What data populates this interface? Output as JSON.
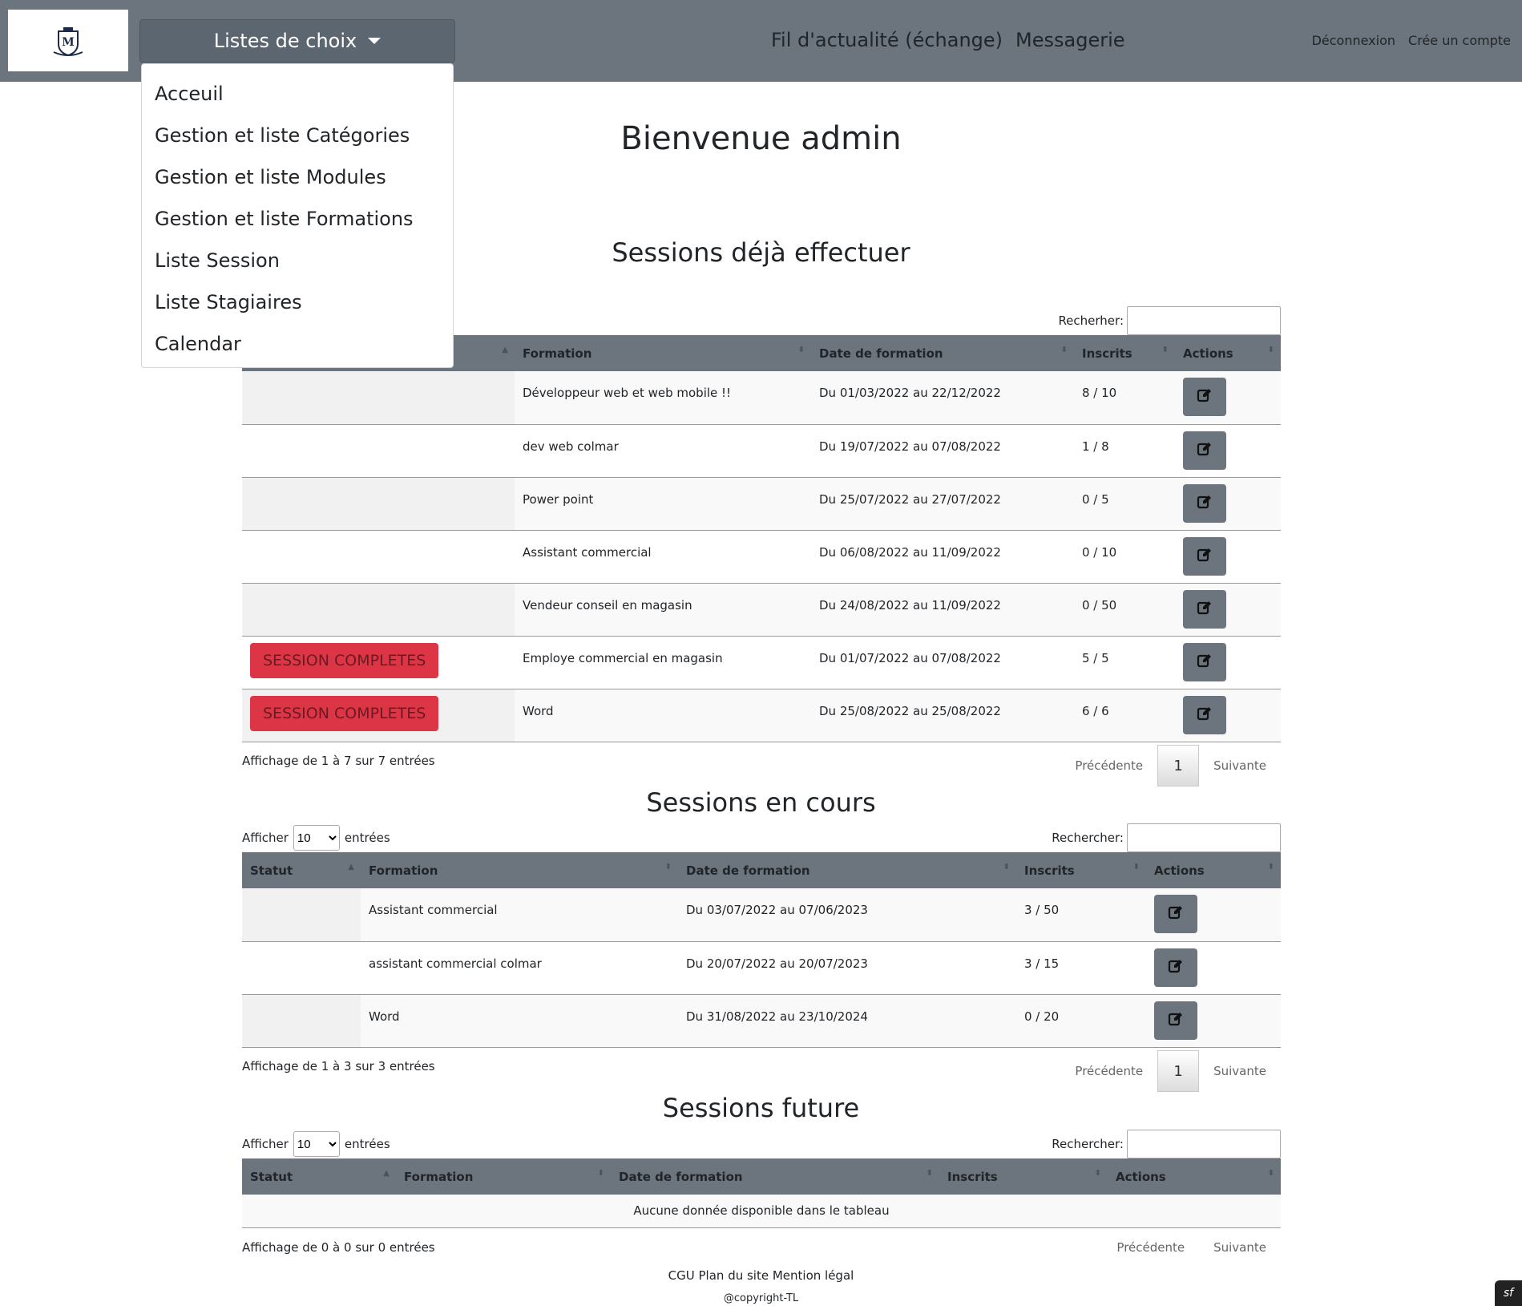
{
  "nav": {
    "dropdown_label": "Listes de choix",
    "center_links": [
      "Fil d'actualité (échange)",
      "Messagerie"
    ],
    "right_links": [
      "Déconnexion",
      "Crée un compte"
    ],
    "bg_color": "#6c757d"
  },
  "dropdown_items": [
    "Acceuil",
    "Gestion et liste Catégories",
    "Gestion et liste Modules",
    "Gestion et liste Formations",
    "Liste Session",
    "Liste Stagiaires",
    "Calendar"
  ],
  "page_title": "Bienvenue admin",
  "done": {
    "title": "Sessions déjà effectuer",
    "search_label": "Recherher:",
    "headers": [
      "Formation",
      "Date de formation",
      "Inscrits",
      "Actions"
    ],
    "rows": [
      {
        "statut": "",
        "formation": "Développeur web et web mobile !!",
        "date": "Du 01/03/2022 au 22/12/2022",
        "inscrits": "8 / 10"
      },
      {
        "statut": "",
        "formation": "dev web colmar",
        "date": "Du 19/07/2022 au 07/08/2022",
        "inscrits": "1 / 8"
      },
      {
        "statut": "",
        "formation": "Power point",
        "date": "Du 25/07/2022 au 27/07/2022",
        "inscrits": "0 / 5"
      },
      {
        "statut": "",
        "formation": "Assistant commercial",
        "date": "Du 06/08/2022 au 11/09/2022",
        "inscrits": "0 / 10"
      },
      {
        "statut": "",
        "formation": "Vendeur conseil en magasin",
        "date": "Du 24/08/2022 au 11/09/2022",
        "inscrits": "0 / 50"
      },
      {
        "statut": "SESSION COMPLETES",
        "formation": "Employe commercial en magasin",
        "date": "Du 01/07/2022 au 07/08/2022",
        "inscrits": "5 / 5"
      },
      {
        "statut": "SESSION COMPLETES",
        "formation": "Word",
        "date": "Du 25/08/2022 au 25/08/2022",
        "inscrits": "6 / 6"
      }
    ],
    "info": "Affichage de 1 à 7 sur 7 entrées",
    "prev": "Précédente",
    "page": "1",
    "next": "Suivante"
  },
  "current": {
    "title": "Sessions en cours",
    "show_label": "Afficher",
    "show_value": "10",
    "entries_label": "entrées",
    "search_label": "Rechercher:",
    "headers": [
      "Statut",
      "Formation",
      "Date de formation",
      "Inscrits",
      "Actions"
    ],
    "rows": [
      {
        "statut": "",
        "formation": "Assistant commercial",
        "date": "Du 03/07/2022 au 07/06/2023",
        "inscrits": "3 / 50"
      },
      {
        "statut": "",
        "formation": "assistant commercial colmar",
        "date": "Du 20/07/2022 au 20/07/2023",
        "inscrits": "3 / 15"
      },
      {
        "statut": "",
        "formation": "Word",
        "date": "Du 31/08/2022 au 23/10/2024",
        "inscrits": "0 / 20"
      }
    ],
    "info": "Affichage de 1 à 3 sur 3 entrées",
    "prev": "Précédente",
    "page": "1",
    "next": "Suivante"
  },
  "future": {
    "title": "Sessions future",
    "show_label": "Afficher",
    "show_value": "10",
    "entries_label": "entrées",
    "search_label": "Rechercher:",
    "headers": [
      "Statut",
      "Formation",
      "Date de formation",
      "Inscrits",
      "Actions"
    ],
    "empty": "Aucune donnée disponible dans le tableau",
    "info": "Affichage de 0 à 0 sur 0 entrées",
    "prev": "Précédente",
    "next": "Suivante"
  },
  "footer": {
    "links": "CGU Plan du site Mention légal",
    "copyright": "@copyright-TL"
  },
  "colors": {
    "danger": "#dc3545",
    "secondary": "#6c757d"
  }
}
